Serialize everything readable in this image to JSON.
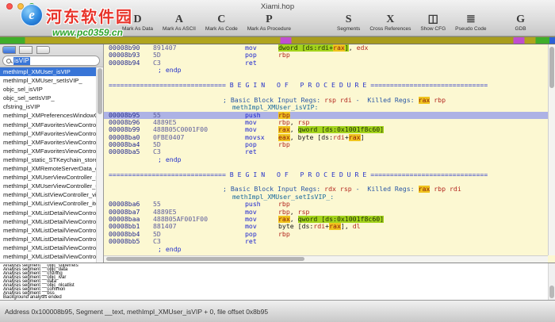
{
  "window": {
    "title": "Xiami.hop"
  },
  "watermark": {
    "site_name": "河东软件园",
    "site_url": "www.pc0359.cn"
  },
  "toolbar": {
    "items": [
      {
        "letter": "D",
        "label": "Mark As Data"
      },
      {
        "letter": "A",
        "label": "Mark As ASCII"
      },
      {
        "letter": "C",
        "label": "Mark As Code"
      },
      {
        "letter": "P",
        "label": "Mark As Procedure"
      },
      {
        "letter": "S",
        "label": "Segments"
      },
      {
        "letter": "X",
        "label": "Cross References"
      },
      {
        "letter": "◫",
        "label": "Show CFG",
        "icon": "cfg-icon"
      },
      {
        "letter": "≣",
        "label": "Pseudo Code",
        "icon": "pseudo-code-icon"
      },
      {
        "letter": "G",
        "label": "GDB"
      }
    ]
  },
  "sidebar": {
    "search_value": "isVIP",
    "items": [
      {
        "label": "methImpl_XMUser_isVIP",
        "selected": true
      },
      {
        "label": "methImpl_XMUser_setIsVIP_"
      },
      {
        "label": "objc_sel_isVIP"
      },
      {
        "label": "objc_sel_setIsVIP_"
      },
      {
        "label": "cfstring_isVIP"
      },
      {
        "label": "methImpl_XMPreferencesWindowControll..."
      },
      {
        "label": "methImpl_XMFavoritesViewController_vi..."
      },
      {
        "label": "methImpl_XMFavoritesViewController_se..."
      },
      {
        "label": "methImpl_XMFavoritesViewController_up..."
      },
      {
        "label": "methImpl_XMFavoritesViewController_ce..."
      },
      {
        "label": "methImpl_static_STKeychain_storeUser..."
      },
      {
        "label": "methImpl_XMRemoteServerData_descrip..."
      },
      {
        "label": "methImpl_XMUserViewController_setting..."
      },
      {
        "label": "methImpl_XMUserViewController_update..."
      },
      {
        "label": "methImpl_XMListViewController_viewDid..."
      },
      {
        "label": "methImpl_XMListViewController_itemList..."
      },
      {
        "label": "methImpl_XMListDetailViewController_vi..."
      },
      {
        "label": "methImpl_XMListDetailViewController_se..."
      },
      {
        "label": "methImpl_XMListDetailViewController_up..."
      },
      {
        "label": "methImpl_XMListDetailViewController_ce..."
      },
      {
        "label": "methImpl_XMListDetailViewController_ite..."
      },
      {
        "label": "methImpl_XMListDetailViewController_..."
      }
    ]
  },
  "assembly": {
    "lines": [
      {
        "type": "code",
        "addr": "00008b90",
        "bytes": "891407",
        "mn": "mov",
        "ops": [
          {
            "t": "mem",
            "s": "dword [ds:rdi+"
          },
          {
            "t": "rhl",
            "s": "rax"
          },
          {
            "t": "mem",
            "s": "]"
          },
          {
            "t": "p",
            "s": ", "
          },
          {
            "t": "reg",
            "s": "edx"
          }
        ]
      },
      {
        "type": "code",
        "addr": "00008b93",
        "bytes": "5D",
        "mn": "pop",
        "ops": [
          {
            "t": "reg",
            "s": "rbp"
          }
        ]
      },
      {
        "type": "code",
        "addr": "00008b94",
        "bytes": "C3",
        "mn": "ret",
        "ops": []
      },
      {
        "type": "endp",
        "text": "; endp"
      },
      {
        "type": "blank"
      },
      {
        "type": "sep",
        "text": "============================== B E G I N   O F   P R O C E D U R E =============================="
      },
      {
        "type": "blank"
      },
      {
        "type": "comment",
        "tokens": [
          {
            "t": "c",
            "s": "; Basic Block Input Regs: "
          },
          {
            "t": "reg",
            "s": "rsp"
          },
          {
            "t": "c",
            "s": " "
          },
          {
            "t": "reg",
            "s": "rdi"
          },
          {
            "t": "c",
            "s": " -  Killed Regs: "
          },
          {
            "t": "rhl",
            "s": "rax"
          },
          {
            "t": "c",
            "s": " "
          },
          {
            "t": "reg",
            "s": "rbp"
          }
        ]
      },
      {
        "type": "label",
        "text": "methImpl_XMUser_isVIP:"
      },
      {
        "type": "code",
        "sel": true,
        "addr": "00008b95",
        "bytes": "55",
        "mn": "push",
        "ops": [
          {
            "t": "rhl",
            "s": "rbp"
          }
        ]
      },
      {
        "type": "code",
        "addr": "00008b96",
        "bytes": "4889E5",
        "mn": "mov",
        "ops": [
          {
            "t": "reg",
            "s": "rbp"
          },
          {
            "t": "p",
            "s": ", "
          },
          {
            "t": "reg",
            "s": "rsp"
          }
        ]
      },
      {
        "type": "code",
        "addr": "00008b99",
        "bytes": "488B05C0001F00",
        "mn": "mov",
        "ops": [
          {
            "t": "rhl",
            "s": "rax"
          },
          {
            "t": "p",
            "s": ", "
          },
          {
            "t": "mem",
            "s": "qword [ds:0x1001f8c60]"
          }
        ]
      },
      {
        "type": "code",
        "addr": "00008ba0",
        "bytes": "0FBE0407",
        "mn": "movsx",
        "ops": [
          {
            "t": "rhl",
            "s": "eax"
          },
          {
            "t": "p",
            "s": ", "
          },
          {
            "t": "p",
            "s": "byte [ds:"
          },
          {
            "t": "reg",
            "s": "rdi"
          },
          {
            "t": "p",
            "s": "+"
          },
          {
            "t": "rhl",
            "s": "rax"
          },
          {
            "t": "p",
            "s": "]"
          }
        ]
      },
      {
        "type": "code",
        "addr": "00008ba4",
        "bytes": "5D",
        "mn": "pop",
        "ops": [
          {
            "t": "reg",
            "s": "rbp"
          }
        ]
      },
      {
        "type": "code",
        "addr": "00008ba5",
        "bytes": "C3",
        "mn": "ret",
        "ops": []
      },
      {
        "type": "endp",
        "text": "; endp"
      },
      {
        "type": "blank"
      },
      {
        "type": "sep",
        "text": "============================== B E G I N   O F   P R O C E D U R E =============================="
      },
      {
        "type": "blank"
      },
      {
        "type": "comment",
        "tokens": [
          {
            "t": "c",
            "s": "; Basic Block Input Regs: "
          },
          {
            "t": "reg",
            "s": "rdx"
          },
          {
            "t": "c",
            "s": " "
          },
          {
            "t": "reg",
            "s": "rsp"
          },
          {
            "t": "c",
            "s": " -  Killed Regs: "
          },
          {
            "t": "rhl",
            "s": "rax"
          },
          {
            "t": "c",
            "s": " "
          },
          {
            "t": "reg",
            "s": "rbp"
          },
          {
            "t": "c",
            "s": " "
          },
          {
            "t": "reg",
            "s": "rdi"
          }
        ]
      },
      {
        "type": "label",
        "text": "methImpl_XMUser_setIsVIP_:"
      },
      {
        "type": "code",
        "addr": "00008ba6",
        "bytes": "55",
        "mn": "push",
        "ops": [
          {
            "t": "reg",
            "s": "rbp"
          }
        ]
      },
      {
        "type": "code",
        "addr": "00008ba7",
        "bytes": "4889E5",
        "mn": "mov",
        "ops": [
          {
            "t": "reg",
            "s": "rbp"
          },
          {
            "t": "p",
            "s": ", "
          },
          {
            "t": "reg",
            "s": "rsp"
          }
        ]
      },
      {
        "type": "code",
        "addr": "00008baa",
        "bytes": "488B05AF001F00",
        "mn": "mov",
        "ops": [
          {
            "t": "rhl",
            "s": "rax"
          },
          {
            "t": "p",
            "s": ", "
          },
          {
            "t": "mem",
            "s": "qword [ds:0x1001f8c60]"
          }
        ]
      },
      {
        "type": "code",
        "addr": "00008bb1",
        "bytes": "881407",
        "mn": "mov",
        "ops": [
          {
            "t": "p",
            "s": "byte [ds:"
          },
          {
            "t": "reg",
            "s": "rdi"
          },
          {
            "t": "p",
            "s": "+"
          },
          {
            "t": "rhl",
            "s": "rax"
          },
          {
            "t": "p",
            "s": "]"
          },
          {
            "t": "p",
            "s": ", "
          },
          {
            "t": "reg",
            "s": "dl"
          }
        ]
      },
      {
        "type": "code",
        "addr": "00008bb4",
        "bytes": "5D",
        "mn": "pop",
        "ops": [
          {
            "t": "reg",
            "s": "rbp"
          }
        ]
      },
      {
        "type": "code",
        "addr": "00008bb5",
        "bytes": "C3",
        "mn": "ret",
        "ops": []
      },
      {
        "type": "endp",
        "text": "; endp"
      }
    ]
  },
  "log": {
    "lines": [
      "Analysis segment __objc_superrefs",
      "Analysis segment __objc_data",
      "Analysis segment __cfstring",
      "Analysis segment __objc_ivar",
      "Analysis segment __data",
      "Analysis segment __objc_nlcatlist",
      "Analysis segment __common",
      "Analysis segment __bss",
      "Background analysis ended"
    ]
  },
  "statusbar": {
    "text": "Address 0x100008b95, Segment __text, methImpl_XMUser_isVIP + 0, file offset 0x8b95"
  }
}
